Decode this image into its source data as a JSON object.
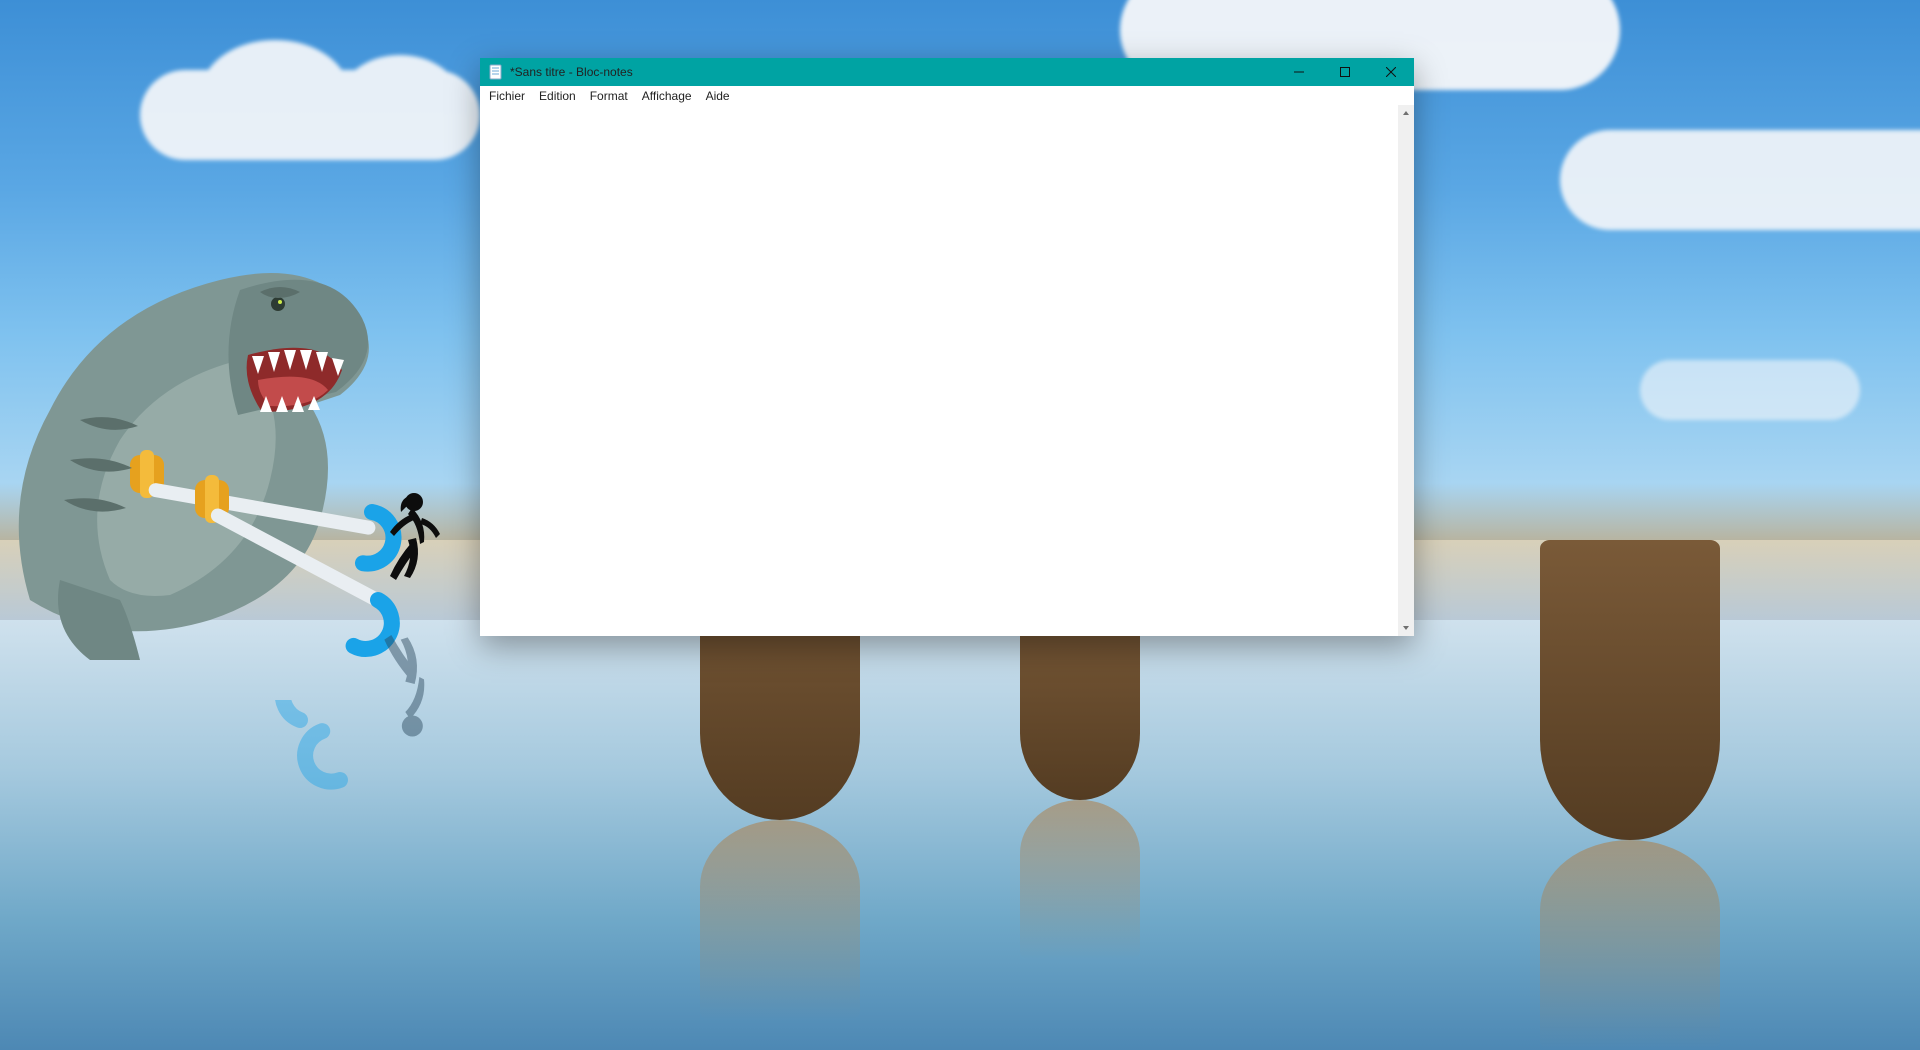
{
  "window": {
    "title": "*Sans titre - Bloc-notes",
    "accent_color": "#00a3a3"
  },
  "menu": {
    "items": [
      "Fichier",
      "Edition",
      "Format",
      "Affichage",
      "Aide"
    ]
  },
  "editor": {
    "content": ""
  }
}
